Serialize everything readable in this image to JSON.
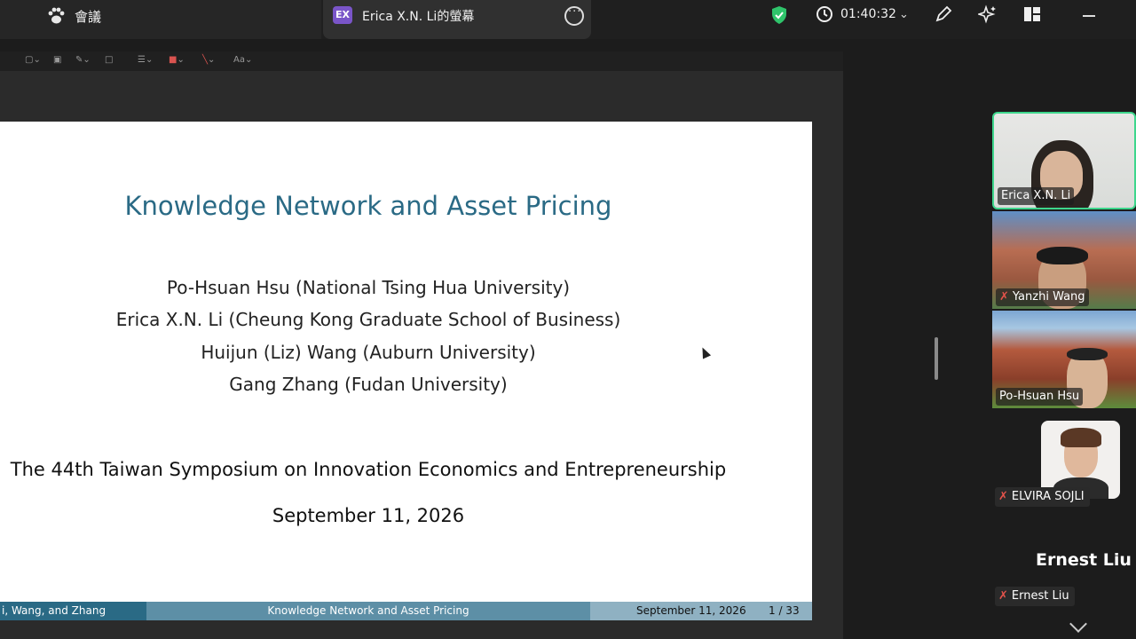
{
  "topbar": {
    "meeting_tab_label": "會議",
    "share_tab_badge": "EX",
    "share_tab_label": "Erica X.N. Li的螢幕",
    "timer": "01:40:32"
  },
  "slide": {
    "title": "Knowledge Network and Asset Pricing",
    "authors": [
      "Po-Hsuan Hsu (National Tsing Hua University)",
      "Erica X.N. Li (Cheung Kong Graduate School of Business)",
      "Huijun (Liz) Wang (Auburn University)",
      "Gang Zhang (Fudan University)"
    ],
    "conference": "The 44th Taiwan Symposium on Innovation Economics and Entrepreneurship",
    "date": "September 11, 2026",
    "footer_left": "i, Wang, and Zhang",
    "footer_center": "Knowledge Network and Asset Pricing",
    "footer_date": "September 11, 2026",
    "footer_page": "1 / 33"
  },
  "toolbar": {
    "font_label": "Aa"
  },
  "participants": [
    {
      "name": "Erica X.N. Li",
      "muted": false
    },
    {
      "name": "Yanzhi Wang",
      "muted": true
    },
    {
      "name": "Po-Hsuan Hsu",
      "muted": false
    },
    {
      "name": "ELVIRA SOJLI",
      "muted": true
    },
    {
      "name": "Ernest Liu",
      "muted": true
    }
  ],
  "ernest_display": "Ernest Liu",
  "colors": {
    "accent_title": "#2a6a85",
    "active_speaker": "#3dd68c",
    "muted": "#e5534b"
  }
}
